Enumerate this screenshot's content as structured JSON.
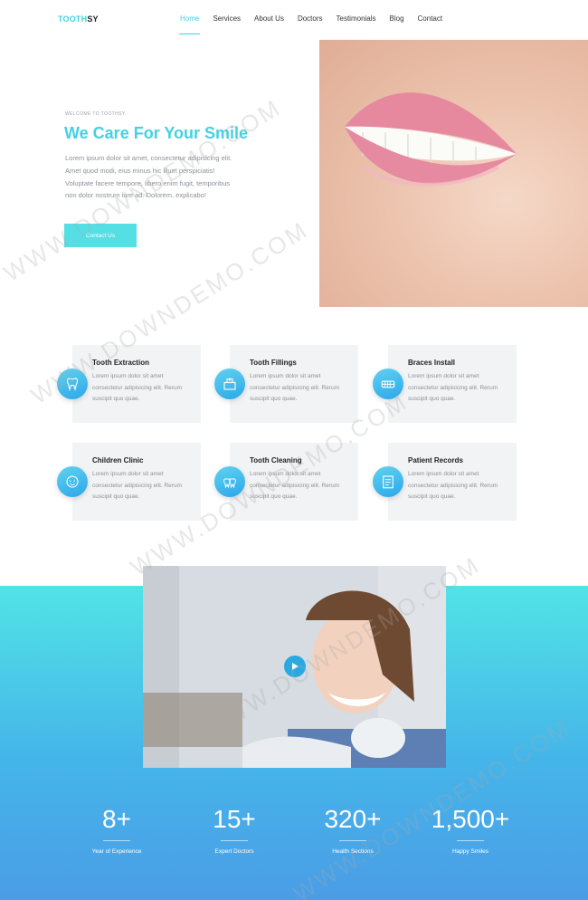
{
  "nav": {
    "logo_part1": "TOOTH",
    "logo_part2": "SY",
    "items": [
      {
        "label": "Home",
        "active": true
      },
      {
        "label": "Services",
        "active": false
      },
      {
        "label": "About Us",
        "active": false
      },
      {
        "label": "Doctors",
        "active": false
      },
      {
        "label": "Testimonials",
        "active": false
      },
      {
        "label": "Blog",
        "active": false
      },
      {
        "label": "Contact",
        "active": false
      }
    ]
  },
  "hero": {
    "eyebrow": "WELCOME TO TOOTHSY",
    "title": "We Care For Your Smile",
    "text": "Lorem ipsum dolor sit amet, consectetur adipisicing elit. Amet quod modi, eius minus hic illum perspiciatis! Voluptate facere tempore, libero enim fugit, temporibus non dolor nostrum iure ad. Dolorem, explicabo!",
    "button": "Contact Us"
  },
  "services": [
    {
      "title": "Tooth Extraction",
      "text": "Lorem ipsum dolor sit amet consectetur adipisicing elit. Rerum suscipit quo quae.",
      "icon": "tooth-extraction-icon"
    },
    {
      "title": "Tooth Fillings",
      "text": "Lorem ipsum dolor sit amet consectetur adipisicing elit. Rerum suscipit quo quae.",
      "icon": "tooth-fillings-icon"
    },
    {
      "title": "Braces Install",
      "text": "Lorem ipsum dolor sit amet consectetur adipisicing elit. Rerum suscipit quo quae.",
      "icon": "braces-icon"
    },
    {
      "title": "Children Clinic",
      "text": "Lorem ipsum dolor sit amet consectetur adipisicing elit. Rerum suscipit quo quae.",
      "icon": "child-face-icon"
    },
    {
      "title": "Tooth Cleaning",
      "text": "Lorem ipsum dolor sit amet consectetur adipisicing elit. Rerum suscipit quo quae.",
      "icon": "tooth-cleaning-icon"
    },
    {
      "title": "Patient Records",
      "text": "Lorem ipsum dolor sit amet consectetur adipisicing elit. Rerum suscipit quo quae.",
      "icon": "patient-records-icon"
    }
  ],
  "stats": [
    {
      "number": "8+",
      "label": "Year of Experience"
    },
    {
      "number": "15+",
      "label": "Expert Doctors"
    },
    {
      "number": "320+",
      "label": "Health Sections"
    },
    {
      "number": "1,500+",
      "label": "Happy Smiles"
    }
  ],
  "watermark": "WWW.DOWNDEMO.COM",
  "colors": {
    "accent": "#43d1e3",
    "button": "#54dfe5",
    "gradient_top": "#52e3e6",
    "gradient_bottom": "#4b9de6"
  }
}
